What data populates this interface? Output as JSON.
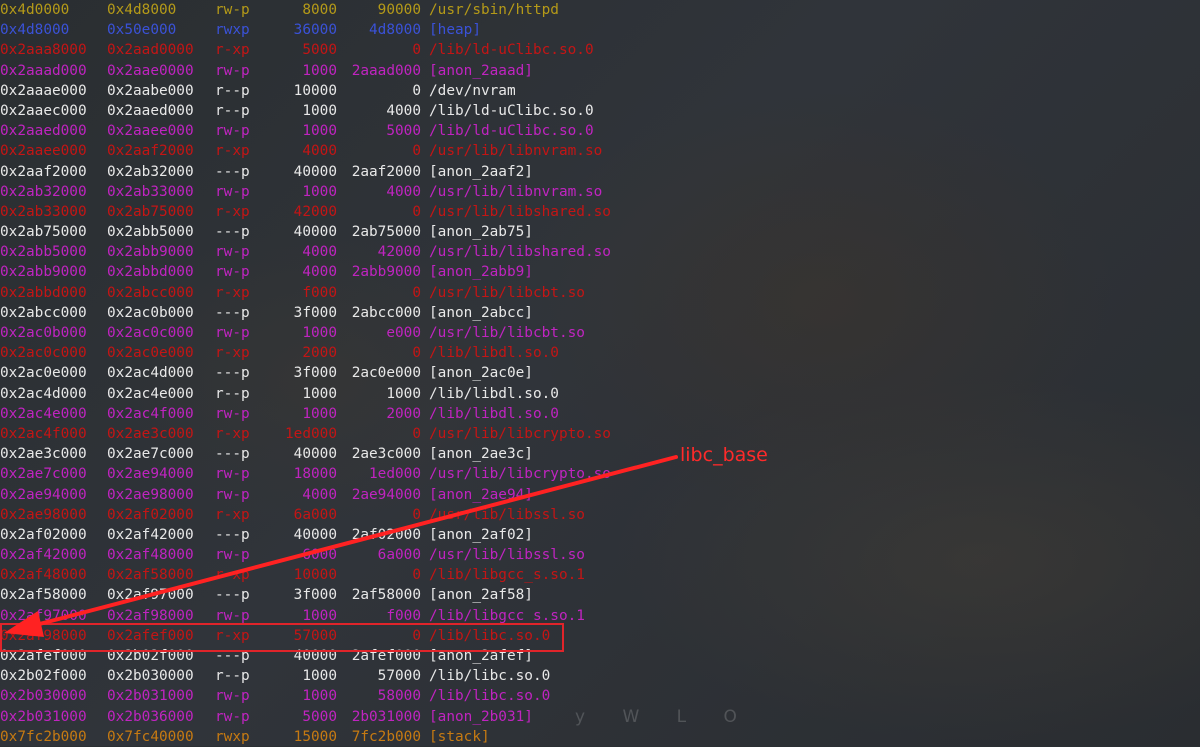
{
  "annotation": {
    "label": "libc_base",
    "color": "#ff2a2a"
  },
  "watermark": "y W L O",
  "maps": [
    {
      "start": "0x4d0000",
      "end": "0x4d8000",
      "perm": "rw-p",
      "size": "8000",
      "offset": "90000",
      "path": "/usr/sbin/httpd",
      "color": "yellow"
    },
    {
      "start": "0x4d8000",
      "end": "0x50e000",
      "perm": "rwxp",
      "size": "36000",
      "offset": "4d8000",
      "path": "[heap]",
      "color": "blue"
    },
    {
      "start": "0x2aaa8000",
      "end": "0x2aad0000",
      "perm": "r-xp",
      "size": "5000",
      "offset": "0",
      "path": "/lib/ld-uClibc.so.0",
      "color": "red"
    },
    {
      "start": "0x2aaad000",
      "end": "0x2aae0000",
      "perm": "rw-p",
      "size": "1000",
      "offset": "2aaad000",
      "path": "[anon_2aaad]",
      "color": "magenta"
    },
    {
      "start": "0x2aaae000",
      "end": "0x2aabe000",
      "perm": "r--p",
      "size": "10000",
      "offset": "0",
      "path": "/dev/nvram",
      "color": "white"
    },
    {
      "start": "0x2aaec000",
      "end": "0x2aaed000",
      "perm": "r--p",
      "size": "1000",
      "offset": "4000",
      "path": "/lib/ld-uClibc.so.0",
      "color": "white"
    },
    {
      "start": "0x2aaed000",
      "end": "0x2aaee000",
      "perm": "rw-p",
      "size": "1000",
      "offset": "5000",
      "path": "/lib/ld-uClibc.so.0",
      "color": "magenta"
    },
    {
      "start": "0x2aaee000",
      "end": "0x2aaf2000",
      "perm": "r-xp",
      "size": "4000",
      "offset": "0",
      "path": "/usr/lib/libnvram.so",
      "color": "red"
    },
    {
      "start": "0x2aaf2000",
      "end": "0x2ab32000",
      "perm": "---p",
      "size": "40000",
      "offset": "2aaf2000",
      "path": "[anon_2aaf2]",
      "color": "white"
    },
    {
      "start": "0x2ab32000",
      "end": "0x2ab33000",
      "perm": "rw-p",
      "size": "1000",
      "offset": "4000",
      "path": "/usr/lib/libnvram.so",
      "color": "magenta"
    },
    {
      "start": "0x2ab33000",
      "end": "0x2ab75000",
      "perm": "r-xp",
      "size": "42000",
      "offset": "0",
      "path": "/usr/lib/libshared.so",
      "color": "red"
    },
    {
      "start": "0x2ab75000",
      "end": "0x2abb5000",
      "perm": "---p",
      "size": "40000",
      "offset": "2ab75000",
      "path": "[anon_2ab75]",
      "color": "white"
    },
    {
      "start": "0x2abb5000",
      "end": "0x2abb9000",
      "perm": "rw-p",
      "size": "4000",
      "offset": "42000",
      "path": "/usr/lib/libshared.so",
      "color": "magenta"
    },
    {
      "start": "0x2abb9000",
      "end": "0x2abbd000",
      "perm": "rw-p",
      "size": "4000",
      "offset": "2abb9000",
      "path": "[anon_2abb9]",
      "color": "magenta"
    },
    {
      "start": "0x2abbd000",
      "end": "0x2abcc000",
      "perm": "r-xp",
      "size": "f000",
      "offset": "0",
      "path": "/usr/lib/libcbt.so",
      "color": "red"
    },
    {
      "start": "0x2abcc000",
      "end": "0x2ac0b000",
      "perm": "---p",
      "size": "3f000",
      "offset": "2abcc000",
      "path": "[anon_2abcc]",
      "color": "white"
    },
    {
      "start": "0x2ac0b000",
      "end": "0x2ac0c000",
      "perm": "rw-p",
      "size": "1000",
      "offset": "e000",
      "path": "/usr/lib/libcbt.so",
      "color": "magenta"
    },
    {
      "start": "0x2ac0c000",
      "end": "0x2ac0e000",
      "perm": "r-xp",
      "size": "2000",
      "offset": "0",
      "path": "/lib/libdl.so.0",
      "color": "red"
    },
    {
      "start": "0x2ac0e000",
      "end": "0x2ac4d000",
      "perm": "---p",
      "size": "3f000",
      "offset": "2ac0e000",
      "path": "[anon_2ac0e]",
      "color": "white"
    },
    {
      "start": "0x2ac4d000",
      "end": "0x2ac4e000",
      "perm": "r--p",
      "size": "1000",
      "offset": "1000",
      "path": "/lib/libdl.so.0",
      "color": "white"
    },
    {
      "start": "0x2ac4e000",
      "end": "0x2ac4f000",
      "perm": "rw-p",
      "size": "1000",
      "offset": "2000",
      "path": "/lib/libdl.so.0",
      "color": "magenta"
    },
    {
      "start": "0x2ac4f000",
      "end": "0x2ae3c000",
      "perm": "r-xp",
      "size": "1ed000",
      "offset": "0",
      "path": "/usr/lib/libcrypto.so",
      "color": "red"
    },
    {
      "start": "0x2ae3c000",
      "end": "0x2ae7c000",
      "perm": "---p",
      "size": "40000",
      "offset": "2ae3c000",
      "path": "[anon_2ae3c]",
      "color": "white"
    },
    {
      "start": "0x2ae7c000",
      "end": "0x2ae94000",
      "perm": "rw-p",
      "size": "18000",
      "offset": "1ed000",
      "path": "/usr/lib/libcrypto.so",
      "color": "magenta"
    },
    {
      "start": "0x2ae94000",
      "end": "0x2ae98000",
      "perm": "rw-p",
      "size": "4000",
      "offset": "2ae94000",
      "path": "[anon_2ae94]",
      "color": "magenta"
    },
    {
      "start": "0x2ae98000",
      "end": "0x2af02000",
      "perm": "r-xp",
      "size": "6a000",
      "offset": "0",
      "path": "/usr/lib/libssl.so",
      "color": "red"
    },
    {
      "start": "0x2af02000",
      "end": "0x2af42000",
      "perm": "---p",
      "size": "40000",
      "offset": "2af02000",
      "path": "[anon_2af02]",
      "color": "white"
    },
    {
      "start": "0x2af42000",
      "end": "0x2af48000",
      "perm": "rw-p",
      "size": "6000",
      "offset": "6a000",
      "path": "/usr/lib/libssl.so",
      "color": "magenta"
    },
    {
      "start": "0x2af48000",
      "end": "0x2af58000",
      "perm": "r-xp",
      "size": "10000",
      "offset": "0",
      "path": "/lib/libgcc_s.so.1",
      "color": "red"
    },
    {
      "start": "0x2af58000",
      "end": "0x2af97000",
      "perm": "---p",
      "size": "3f000",
      "offset": "2af58000",
      "path": "[anon_2af58]",
      "color": "white"
    },
    {
      "start": "0x2af97000",
      "end": "0x2af98000",
      "perm": "rw-p",
      "size": "1000",
      "offset": "f000",
      "path": "/lib/libgcc_s.so.1",
      "color": "magenta"
    },
    {
      "start": "0x2af98000",
      "end": "0x2afef000",
      "perm": "r-xp",
      "size": "57000",
      "offset": "0",
      "path": "/lib/libc.so.0",
      "color": "red",
      "highlighted": true
    },
    {
      "start": "0x2afef000",
      "end": "0x2b02f000",
      "perm": "---p",
      "size": "40000",
      "offset": "2afef000",
      "path": "[anon_2afef]",
      "color": "white"
    },
    {
      "start": "0x2b02f000",
      "end": "0x2b030000",
      "perm": "r--p",
      "size": "1000",
      "offset": "57000",
      "path": "/lib/libc.so.0",
      "color": "white"
    },
    {
      "start": "0x2b030000",
      "end": "0x2b031000",
      "perm": "rw-p",
      "size": "1000",
      "offset": "58000",
      "path": "/lib/libc.so.0",
      "color": "magenta"
    },
    {
      "start": "0x2b031000",
      "end": "0x2b036000",
      "perm": "rw-p",
      "size": "5000",
      "offset": "2b031000",
      "path": "[anon_2b031]",
      "color": "magenta"
    },
    {
      "start": "0x7fc2b000",
      "end": "0x7fc40000",
      "perm": "rwxp",
      "size": "15000",
      "offset": "7fc2b000",
      "path": "[stack]",
      "color": "orange"
    }
  ]
}
